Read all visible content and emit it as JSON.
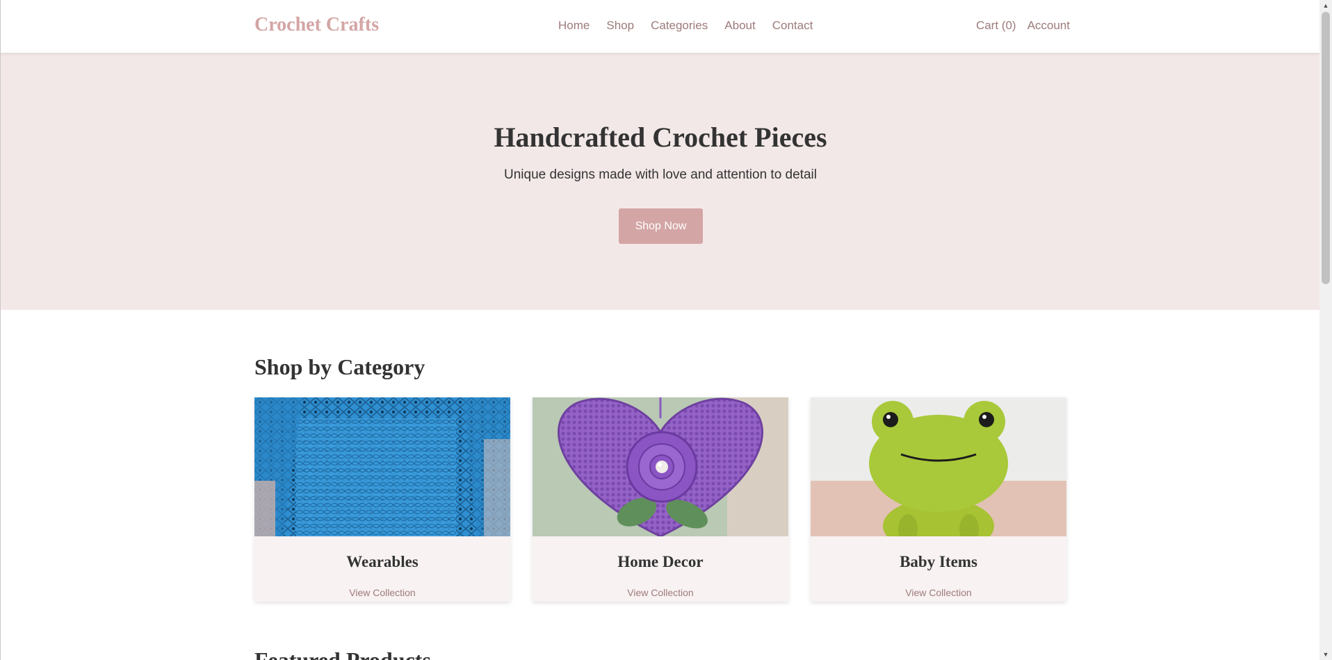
{
  "header": {
    "logo": "Crochet Crafts",
    "nav": [
      "Home",
      "Shop",
      "Categories",
      "About",
      "Contact"
    ],
    "cart": "Cart (0)",
    "account": "Account"
  },
  "hero": {
    "title": "Handcrafted Crochet Pieces",
    "subtitle": "Unique designs made with love and attention to detail",
    "cta": "Shop Now"
  },
  "categories": {
    "title": "Shop by Category",
    "items": [
      {
        "name": "Wearables",
        "link": "View Collection",
        "image": "blue-crochet-sweater"
      },
      {
        "name": "Home Decor",
        "link": "View Collection",
        "image": "purple-crochet-heart"
      },
      {
        "name": "Baby Items",
        "link": "View Collection",
        "image": "green-amigurumi-frog"
      }
    ]
  },
  "featured": {
    "title": "Featured Products"
  },
  "colors": {
    "accent": "#d4a5a5",
    "hero_bg": "#f3e8e8",
    "link": "#9e7a7a"
  }
}
